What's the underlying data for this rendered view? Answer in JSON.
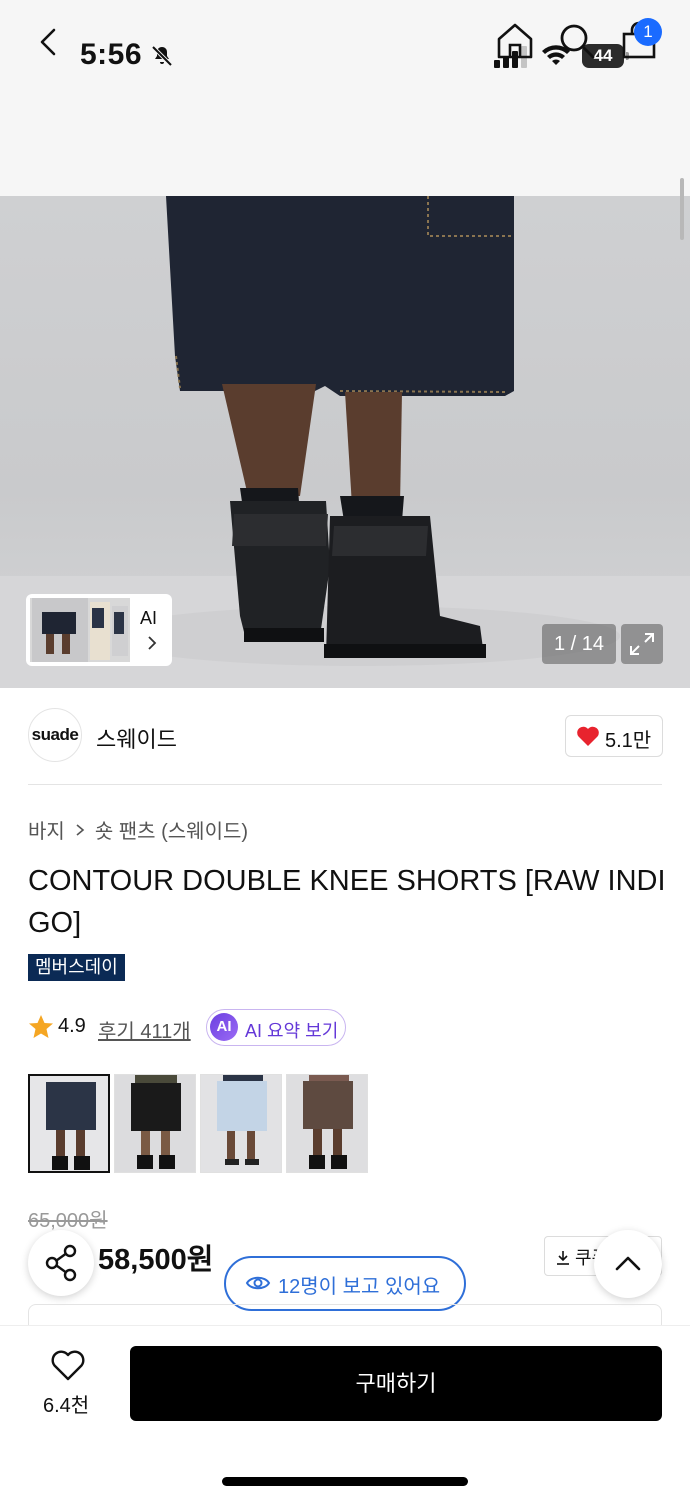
{
  "status_bar": {
    "time": "5:56",
    "battery": "44"
  },
  "nav": {
    "cart_badge": "1"
  },
  "gallery": {
    "ai_label": "AI",
    "counter": "1 / 14"
  },
  "brand": {
    "logo_text": "suade",
    "name": "스웨이드",
    "likes": "5.1만"
  },
  "breadcrumb": {
    "category": "바지",
    "subcategory": "숏 팬츠 (스웨이드)"
  },
  "product": {
    "title": "CONTOUR DOUBLE KNEE SHORTS [RAW INDIGO]",
    "badge": "멤버스데이",
    "rating": "4.9",
    "reviews": "후기 411개",
    "ai_summary_icon": "AI",
    "ai_summary_label": "AI 요약 보기",
    "original_price": "65,000원",
    "sale_price": "58,500원",
    "coupon_label": "쿠폰"
  },
  "variants": [
    {
      "name": "raw-indigo",
      "top": "#2b3446",
      "bottom": "#1d2330",
      "selected": true
    },
    {
      "name": "black",
      "top": "#1a1a1a",
      "bottom": "#111111",
      "selected": false
    },
    {
      "name": "light-blue",
      "top": "#c3d4e6",
      "bottom": "#aec3db",
      "selected": false
    },
    {
      "name": "brown",
      "top": "#5e4a40",
      "bottom": "#4d3b33",
      "selected": false
    }
  ],
  "viewers": {
    "text": "12명이 보고 있어요"
  },
  "bottom_bar": {
    "wishlist_count": "6.4천",
    "buy_label": "구매하기"
  },
  "colors": {
    "accent_blue": "#1a6bff",
    "viewer_blue": "#2f6fd8",
    "member_badge": "#0b2a55",
    "ai_purple": "#6438d8",
    "heart_red": "#e8232e",
    "star": "#f5a623"
  },
  "icons": [
    "bell-slash-icon",
    "signal-icon",
    "wifi-icon",
    "battery-icon",
    "back-icon",
    "home-icon",
    "search-icon",
    "bag-icon",
    "chevron-right-icon",
    "expand-icon",
    "heart-icon",
    "star-icon",
    "share-icon",
    "chevron-up-icon",
    "eye-icon",
    "download-icon"
  ]
}
